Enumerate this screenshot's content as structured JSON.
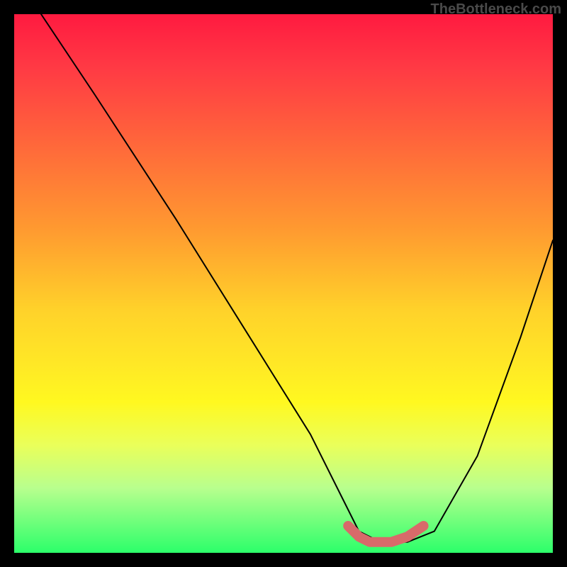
{
  "watermark": "TheBottleneck.com",
  "chart_data": {
    "type": "line",
    "title": "",
    "xlabel": "",
    "ylabel": "",
    "xlim": [
      0,
      100
    ],
    "ylim": [
      0,
      100
    ],
    "background_gradient": {
      "top": "#ff1a40",
      "bottom": "#2cff6a"
    },
    "series": [
      {
        "name": "bottleneck-curve",
        "color": "#000000",
        "width": 2,
        "x": [
          5,
          15,
          30,
          45,
          55,
          61,
          64,
          68,
          73,
          78,
          86,
          94,
          100
        ],
        "y": [
          100,
          85,
          62,
          38,
          22,
          10,
          4,
          2,
          2,
          4,
          18,
          40,
          58
        ]
      },
      {
        "name": "optimal-zone-highlight",
        "color": "#d86a6a",
        "width": 14,
        "x": [
          62,
          64,
          66,
          68,
          70,
          73,
          76
        ],
        "y": [
          5,
          3,
          2,
          2,
          2,
          3,
          5
        ]
      }
    ],
    "annotations": []
  }
}
